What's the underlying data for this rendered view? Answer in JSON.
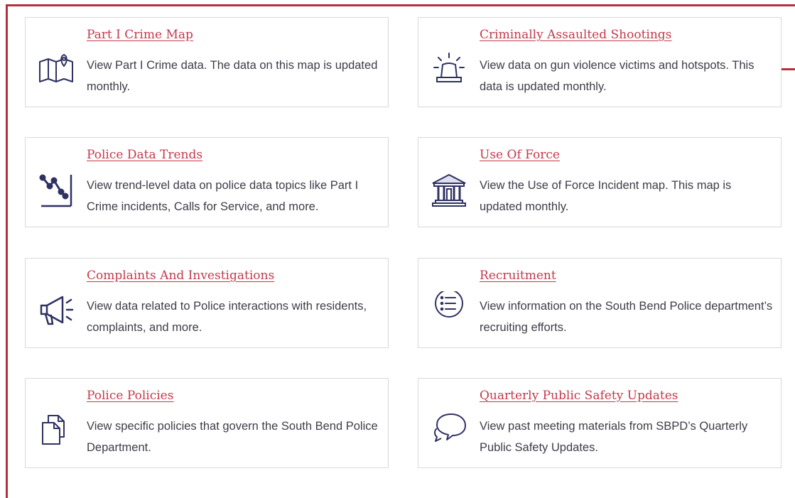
{
  "accent_color": "#c4394a",
  "icon_color": "#2f3163",
  "cards": [
    {
      "title": "Part I Crime Map",
      "desc": "View Part I Crime data. The data on this map is updated monthly.",
      "icon": "map-pin-icon"
    },
    {
      "title": "Criminally Assaulted Shootings",
      "desc": "View data on gun violence victims and hotspots. This data is updated monthly.",
      "icon": "siren-icon"
    },
    {
      "title": "Police Data Trends",
      "desc": "View trend-level data on police data topics like Part I Crime incidents, Calls for Service, and more.",
      "icon": "line-chart-icon"
    },
    {
      "title": "Use Of Force",
      "desc": "View the Use of Force Incident map. This map is updated monthly.",
      "icon": "courthouse-icon"
    },
    {
      "title": "Complaints And Investigations",
      "desc": "View data related to Police interactions with residents, complaints, and more.",
      "icon": "megaphone-icon"
    },
    {
      "title": "Recruitment",
      "desc": "View information on the South Bend Police department’s recruiting efforts.",
      "icon": "list-circle-icon"
    },
    {
      "title": "Police Policies",
      "desc": "View specific policies that govern the South Bend Police Department.",
      "icon": "documents-icon"
    },
    {
      "title": "Quarterly Public Safety Updates",
      "desc": "View past meeting materials from SBPD’s Quarterly Public Safety Updates.",
      "icon": "chat-bubble-icon"
    }
  ]
}
